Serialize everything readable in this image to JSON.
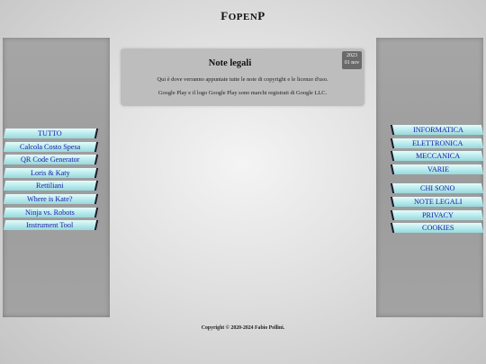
{
  "site": {
    "title_first": "F",
    "title_middle": "OPEN",
    "title_last": "P"
  },
  "left_menu": [
    "TUTTO",
    "Calcola Costo Spesa",
    "QR Code Generator",
    "Loris & Katy",
    "Rettiliani",
    "Where is Kate?",
    "Ninja vs. Robots",
    "Instrument Tool"
  ],
  "right_menu": {
    "categories": [
      "INFORMATICA",
      "ELETTRONICA",
      "MECCANICA",
      "VARIE"
    ],
    "pages": [
      "CHI SONO",
      "NOTE LEGALI",
      "PRIVACY",
      "COOKIES"
    ]
  },
  "post": {
    "title": "Note legali",
    "year": "2023",
    "day_month": "01 nov",
    "line1": "Qui è dove verranno appuntate tutte le note di copyright e le licenze d'uso.",
    "line2": "Google Play e il logo Google Play sono marchi registrati di Google LLC."
  },
  "footer": {
    "copyright": "Copyright © 2020-2024 Fabio Pollini."
  },
  "colors": {
    "menu_link": "#1a1aa6",
    "menu_bg": "#b6eaec",
    "sidebar": "#a0a0a0",
    "card": "#bdbdbd",
    "badge": "#6a6a6a"
  }
}
